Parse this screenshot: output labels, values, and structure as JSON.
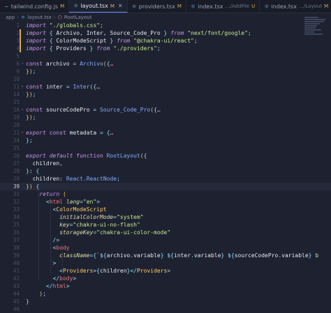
{
  "tabs": [
    {
      "icon": "~",
      "name": "tailwind.config.js",
      "status": "M",
      "path": "",
      "active": false,
      "closable": false
    },
    {
      "icon": "⚛",
      "name": "layout.tsx",
      "status": "M",
      "path": "",
      "active": true,
      "closable": true
    },
    {
      "icon": "⚛",
      "name": "providers.tsx",
      "status": "M",
      "path": "",
      "active": false,
      "closable": false
    },
    {
      "icon": "⚛",
      "name": "index.tsx",
      "status": "U",
      "path": "…/AddFile",
      "active": false,
      "closable": false
    },
    {
      "icon": "⚛",
      "name": "index.tsx",
      "status": "M",
      "path": "…/Layout",
      "active": false,
      "closable": false
    }
  ],
  "breadcrumb": [
    "app",
    "layout.tsx",
    "RootLayout"
  ],
  "lines": [
    {
      "n": "1",
      "segs": [
        [
          "kw",
          "import "
        ],
        [
          "str",
          "\"./globals.css\""
        ],
        [
          "punc",
          ";"
        ]
      ]
    },
    {
      "n": "2",
      "segs": [
        [
          "kw",
          "import "
        ],
        [
          "punc",
          "{ "
        ],
        [
          "var",
          "Archivo, Inter, Source_Code_Pro "
        ],
        [
          "punc",
          "} "
        ],
        [
          "kw",
          "from "
        ],
        [
          "str",
          "\"next/font/google\""
        ],
        [
          "punc",
          ";"
        ]
      ]
    },
    {
      "n": "3",
      "segs": [
        [
          "kw",
          "import "
        ],
        [
          "punc",
          "{ "
        ],
        [
          "var",
          "ColorModeScript "
        ],
        [
          "punc",
          "} "
        ],
        [
          "kw",
          "from "
        ],
        [
          "str",
          "\"@chakra-ui/react\""
        ],
        [
          "punc",
          ";"
        ]
      ]
    },
    {
      "n": "4",
      "segs": [
        [
          "kw",
          "import "
        ],
        [
          "punc",
          "{ "
        ],
        [
          "var",
          "Providers "
        ],
        [
          "punc",
          "} "
        ],
        [
          "kw",
          "from "
        ],
        [
          "str",
          "\"./providers\""
        ],
        [
          "punc",
          ";"
        ]
      ]
    },
    {
      "n": "5",
      "segs": []
    },
    {
      "n": "6",
      "fold": "›",
      "segs": [
        [
          "kw2",
          "const "
        ],
        [
          "var",
          "archivo "
        ],
        [
          "punc",
          "= "
        ],
        [
          "fn",
          "Archivo"
        ],
        [
          "brk",
          "("
        ],
        [
          "punc",
          "{"
        ],
        [
          "ell",
          "…"
        ]
      ]
    },
    {
      "n": "9",
      "segs": [
        [
          "punc",
          "}"
        ],
        [
          "brk",
          ")"
        ],
        [
          "punc",
          ";"
        ]
      ]
    },
    {
      "n": "10",
      "segs": []
    },
    {
      "n": "11",
      "fold": "›",
      "segs": [
        [
          "kw2",
          "const "
        ],
        [
          "var",
          "inter "
        ],
        [
          "punc",
          "= "
        ],
        [
          "fn",
          "Inter"
        ],
        [
          "brk",
          "("
        ],
        [
          "punc",
          "{"
        ],
        [
          "ell",
          "…"
        ]
      ]
    },
    {
      "n": "14",
      "segs": [
        [
          "punc",
          "}"
        ],
        [
          "brk",
          ")"
        ],
        [
          "punc",
          ";"
        ]
      ]
    },
    {
      "n": "15",
      "segs": []
    },
    {
      "n": "16",
      "fold": "›",
      "segs": [
        [
          "kw2",
          "const "
        ],
        [
          "var",
          "sourceCodePro "
        ],
        [
          "punc",
          "= "
        ],
        [
          "fn",
          "Source_Code_Pro"
        ],
        [
          "brk",
          "("
        ],
        [
          "punc",
          "{"
        ],
        [
          "ell",
          "…"
        ]
      ]
    },
    {
      "n": "19",
      "segs": [
        [
          "punc",
          "}"
        ],
        [
          "brk",
          ")"
        ],
        [
          "punc",
          ";"
        ]
      ]
    },
    {
      "n": "20",
      "segs": []
    },
    {
      "n": "21",
      "fold": "›",
      "segs": [
        [
          "kw",
          "export "
        ],
        [
          "kw2",
          "const "
        ],
        [
          "var",
          "metadata "
        ],
        [
          "punc",
          "= {"
        ],
        [
          "ell",
          "…"
        ]
      ]
    },
    {
      "n": "24",
      "segs": [
        [
          "punc",
          "};"
        ]
      ]
    },
    {
      "n": "25",
      "segs": []
    },
    {
      "n": "26",
      "segs": [
        [
          "kw",
          "export default "
        ],
        [
          "kw2",
          "function "
        ],
        [
          "fn",
          "RootLayout"
        ],
        [
          "brk",
          "("
        ],
        [
          "punc",
          "{"
        ]
      ]
    },
    {
      "n": "27",
      "segs": [
        [
          "var",
          "  children"
        ],
        [
          "punc",
          ","
        ]
      ]
    },
    {
      "n": "28",
      "segs": [
        [
          "punc",
          "}"
        ],
        [
          "var",
          ": "
        ],
        [
          "punc",
          "{"
        ]
      ]
    },
    {
      "n": "29",
      "segs": [
        [
          "var",
          "  children"
        ],
        [
          "punc",
          ": "
        ],
        [
          "typ",
          "React"
        ],
        [
          "punc",
          "."
        ],
        [
          "typ",
          "ReactNode"
        ],
        [
          "punc",
          ";"
        ]
      ]
    },
    {
      "n": "39",
      "current": true,
      "segs": [
        [
          "punc",
          "}"
        ],
        [
          "brk",
          ")"
        ],
        [
          "var",
          " "
        ],
        [
          "punc",
          "{"
        ]
      ]
    },
    {
      "n": "31",
      "segs": [
        [
          "kw",
          "    return "
        ],
        [
          "brk",
          "("
        ]
      ]
    },
    {
      "n": "32",
      "segs": [
        [
          "var",
          "      "
        ],
        [
          "punc",
          "<"
        ],
        [
          "tag",
          "html "
        ],
        [
          "prop",
          "lang"
        ],
        [
          "punc",
          "="
        ],
        [
          "str",
          "\"en\""
        ],
        [
          "punc",
          ">"
        ]
      ]
    },
    {
      "n": "33",
      "segs": [
        [
          "var",
          "        "
        ],
        [
          "punc",
          "<"
        ],
        [
          "cmp",
          "ColorModeScript"
        ]
      ]
    },
    {
      "n": "34",
      "segs": [
        [
          "var",
          "          "
        ],
        [
          "prop",
          "initialColorMode"
        ],
        [
          "punc",
          "="
        ],
        [
          "str",
          "\"system\""
        ]
      ]
    },
    {
      "n": "35",
      "segs": [
        [
          "var",
          "          "
        ],
        [
          "prop",
          "key"
        ],
        [
          "punc",
          "="
        ],
        [
          "str",
          "\"chakra-ui-no-flash\""
        ]
      ]
    },
    {
      "n": "36",
      "segs": [
        [
          "var",
          "          "
        ],
        [
          "prop",
          "storageKey"
        ],
        [
          "punc",
          "="
        ],
        [
          "str",
          "\"chakra-ui-color-mode\""
        ]
      ]
    },
    {
      "n": "37",
      "segs": [
        [
          "var",
          "        "
        ],
        [
          "punc",
          "/>"
        ]
      ]
    },
    {
      "n": "38",
      "segs": [
        [
          "var",
          "        "
        ],
        [
          "punc",
          "<"
        ],
        [
          "tag",
          "body"
        ]
      ]
    },
    {
      "n": "39",
      "segs": [
        [
          "var",
          "          "
        ],
        [
          "prop",
          "className"
        ],
        [
          "punc",
          "={`${"
        ],
        [
          "var",
          "archivo"
        ],
        [
          "punc",
          "."
        ],
        [
          "var",
          "variable"
        ],
        [
          "punc",
          "} ${"
        ],
        [
          "var",
          "inter"
        ],
        [
          "punc",
          "."
        ],
        [
          "var",
          "variable"
        ],
        [
          "punc",
          "} ${"
        ],
        [
          "var",
          "sourceCodePro"
        ],
        [
          "punc",
          "."
        ],
        [
          "var",
          "variable"
        ],
        [
          "punc",
          "} "
        ],
        [
          "str",
          "b"
        ]
      ]
    },
    {
      "n": "40",
      "segs": [
        [
          "var",
          "        "
        ],
        [
          "punc",
          ">"
        ]
      ]
    },
    {
      "n": "41",
      "segs": [
        [
          "var",
          "          "
        ],
        [
          "punc",
          "<"
        ],
        [
          "cmp",
          "Providers"
        ],
        [
          "punc",
          ">{"
        ],
        [
          "var",
          "children"
        ],
        [
          "punc",
          "}</"
        ],
        [
          "cmp",
          "Providers"
        ],
        [
          "punc",
          ">"
        ]
      ]
    },
    {
      "n": "42",
      "segs": [
        [
          "var",
          "        "
        ],
        [
          "punc",
          "</"
        ],
        [
          "tag",
          "body"
        ],
        [
          "punc",
          ">"
        ]
      ]
    },
    {
      "n": "43",
      "segs": [
        [
          "var",
          "      "
        ],
        [
          "punc",
          "</"
        ],
        [
          "tag",
          "html"
        ],
        [
          "punc",
          ">"
        ]
      ]
    },
    {
      "n": "44",
      "segs": [
        [
          "var",
          "    "
        ],
        [
          "brk",
          ")"
        ],
        [
          "punc",
          ";"
        ]
      ]
    },
    {
      "n": "45",
      "segs": [
        [
          "punc",
          "}"
        ]
      ]
    },
    {
      "n": "46",
      "segs": []
    }
  ]
}
